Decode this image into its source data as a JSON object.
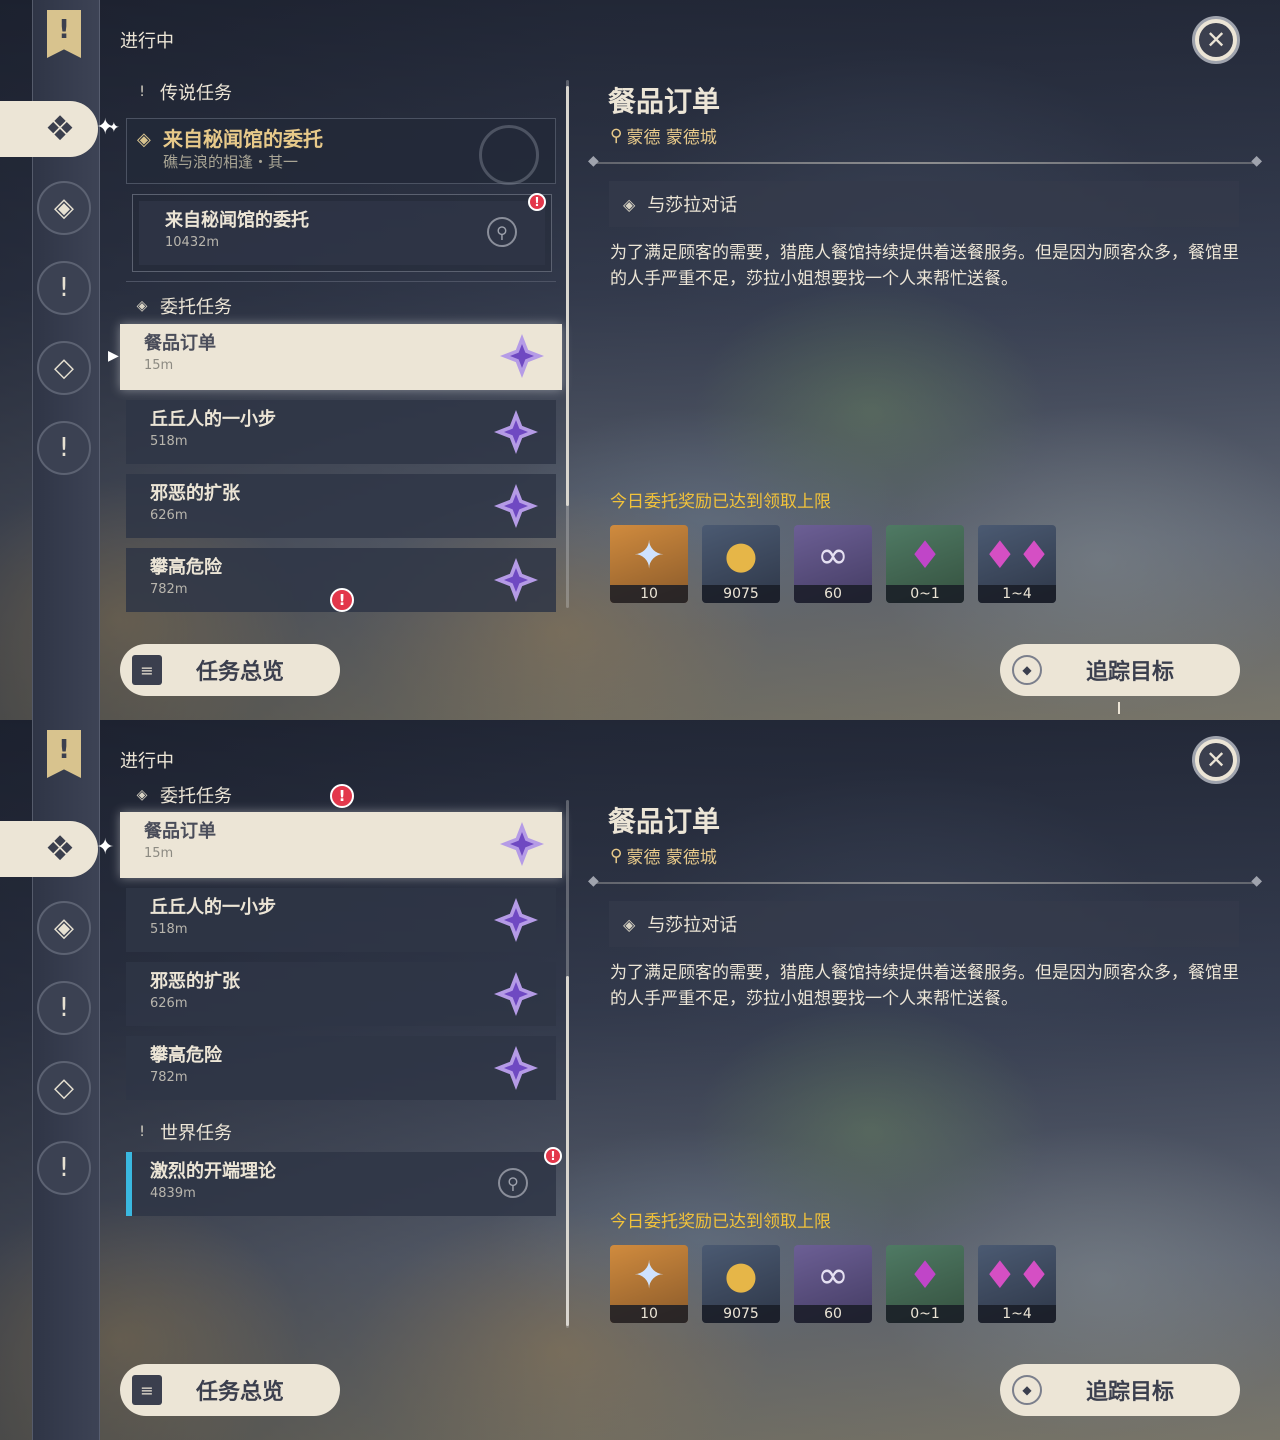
{
  "shared": {
    "status_label": "进行中",
    "close_glyph": "✕",
    "overview_button": "任务总览",
    "track_button": "追踪目标",
    "rail_icons": [
      "quest-banner-icon",
      "commission-tab-icon",
      "archon-quest-icon",
      "legend-quest-icon",
      "commission-quest-icon",
      "world-quest-icon"
    ],
    "detail": {
      "title": "餐品订单",
      "location": "蒙德 蒙德城",
      "objective": "与莎拉对话",
      "description": "为了满足顾客的需要，猎鹿人餐馆持续提供着送餐服务。但是因为顾客众多，餐馆里的人手严重不足，莎拉小姐想要找一个人来帮忙送餐。",
      "reward_notice": "今日委托奖励已达到领取上限",
      "rewards": [
        {
          "name": "primogem-icon",
          "qty": "10",
          "bg": "orange"
        },
        {
          "name": "mora-icon",
          "qty": "9075",
          "bg": "slate"
        },
        {
          "name": "friendship-exp-icon",
          "qty": "60",
          "bg": "purple"
        },
        {
          "name": "crystal-chunk-icon",
          "qty": "0~1",
          "bg": "green"
        },
        {
          "name": "crystal-ore-icon",
          "qty": "1~4",
          "bg": "slate"
        }
      ]
    }
  },
  "top": {
    "legend_section": "传说任务",
    "legend_quest": {
      "title": "来自秘闻馆的委托",
      "subtitle": "礁与浪的相逢・其一"
    },
    "legend_sub": {
      "title": "来自秘闻馆的委托",
      "distance": "10432m"
    },
    "commission_section": "委托任务",
    "commissions": [
      {
        "title": "餐品订单",
        "distance": "15m"
      },
      {
        "title": "丘丘人的一小步",
        "distance": "518m"
      },
      {
        "title": "邪恶的扩张",
        "distance": "626m"
      },
      {
        "title": "攀高危险",
        "distance": "782m"
      }
    ]
  },
  "bottom": {
    "commission_section": "委托任务",
    "commissions": [
      {
        "title": "餐品订单",
        "distance": "15m"
      },
      {
        "title": "丘丘人的一小步",
        "distance": "518m"
      },
      {
        "title": "邪恶的扩张",
        "distance": "626m"
      },
      {
        "title": "攀高危险",
        "distance": "782m"
      }
    ],
    "world_section": "世界任务",
    "world_quest": {
      "title": "激烈的开端理论",
      "distance": "4839m"
    }
  }
}
